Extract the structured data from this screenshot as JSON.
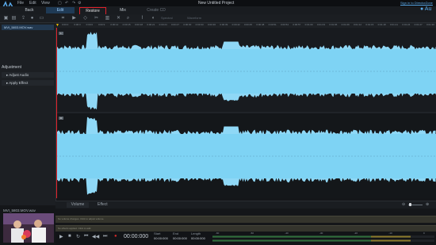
{
  "window": {
    "title": "New Untitled Project",
    "signin": "Sign in to DirectorZone",
    "brand": "Au"
  },
  "menu": [
    "File",
    "Edit",
    "View"
  ],
  "tabs": {
    "back": "Back",
    "edit": "Edit",
    "restore": "Restore",
    "mix": "Mix",
    "create_cd": "Create CD"
  },
  "toolbar": {
    "icons": [
      "open-icon",
      "save-icon",
      "import-icon",
      "record-icon",
      "export-icon",
      "crop-icon",
      "undo-icon",
      "redo-icon",
      "cut-icon",
      "paste-icon",
      "delete-icon"
    ],
    "mode_label": "Spectral",
    "trim_label": "Waveform"
  },
  "media": {
    "item": "MVI_5803.MOV.wav"
  },
  "adjustment": {
    "heading": "Adjustment",
    "items": [
      "Adjust Audio",
      "Apply Effect"
    ]
  },
  "file": {
    "name": "MVI_5803.MOV.wav"
  },
  "ruler": [
    "0:00:0",
    "0:00:3",
    "0:00:6",
    "0:00:9",
    "0:00:12",
    "0:00:15",
    "0:00:18",
    "0:00:21",
    "0:00:24",
    "0:00:27",
    "0:00:30",
    "0:00:33",
    "0:00:36",
    "0:00:39",
    "0:00:42",
    "0:00:45",
    "0:00:48",
    "0:00:51",
    "0:00:54",
    "0:00:57",
    "0:01:00",
    "0:01:03",
    "0:01:06",
    "0:01:09",
    "0:01:12",
    "0:01:15",
    "0:01:18",
    "0:01:21",
    "0:01:24",
    "0:01:27",
    "0:01:30"
  ],
  "channels": {
    "left": "L",
    "right": "R"
  },
  "effect_tabs": {
    "volume": "Volume",
    "effect": "Effect"
  },
  "tracks": [
    "No volume changes. Click to adjust volume.",
    "No effects applied. Click to add."
  ],
  "transport": {
    "timecode": "00:00:000",
    "start_label": "Start",
    "start_value": "00:00:000",
    "end_label": "End",
    "end_value": "00:00:000",
    "length_label": "Length",
    "length_value": "00:00:000"
  },
  "meter": {
    "labels": [
      "-60",
      "-50",
      "-40",
      "-30",
      "-20",
      "-10",
      "0"
    ]
  },
  "colors": {
    "accent": "#5aa8e8",
    "wave": "#8fd8f6",
    "restore_border": "#e0212b"
  }
}
